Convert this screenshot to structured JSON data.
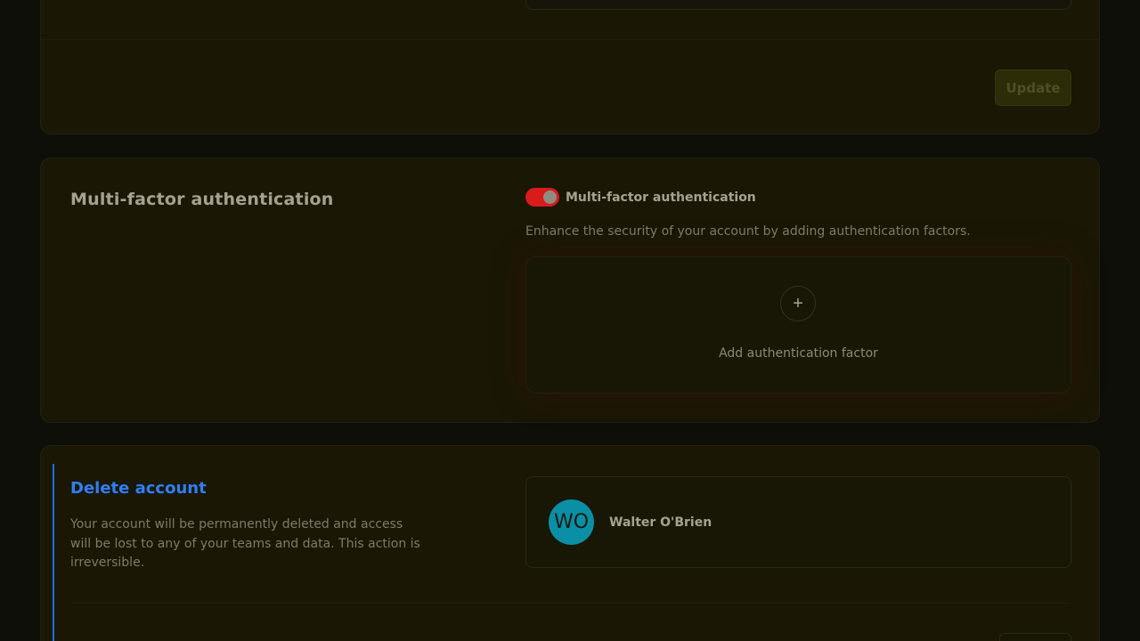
{
  "update_section": {
    "update_button_label": "Update"
  },
  "mfa": {
    "title": "Multi-factor authentication",
    "toggle_label": "Multi-factor authentication",
    "toggle_on": true,
    "description": "Enhance the security of your account by adding authentication factors.",
    "add_factor_label": "Add authentication factor",
    "add_icon": "plus-icon",
    "colors": {
      "toggle_on": "#d81b1b"
    }
  },
  "delete_account": {
    "title": "Delete account",
    "description": "Your account will be permanently deleted and access will be lost to any of your teams and data. This action is irreversible.",
    "user": {
      "initials": "WO",
      "name": "Walter O'Brien"
    },
    "colors": {
      "accent": "#2f7ff5",
      "avatar": "#0b8fa5"
    }
  }
}
